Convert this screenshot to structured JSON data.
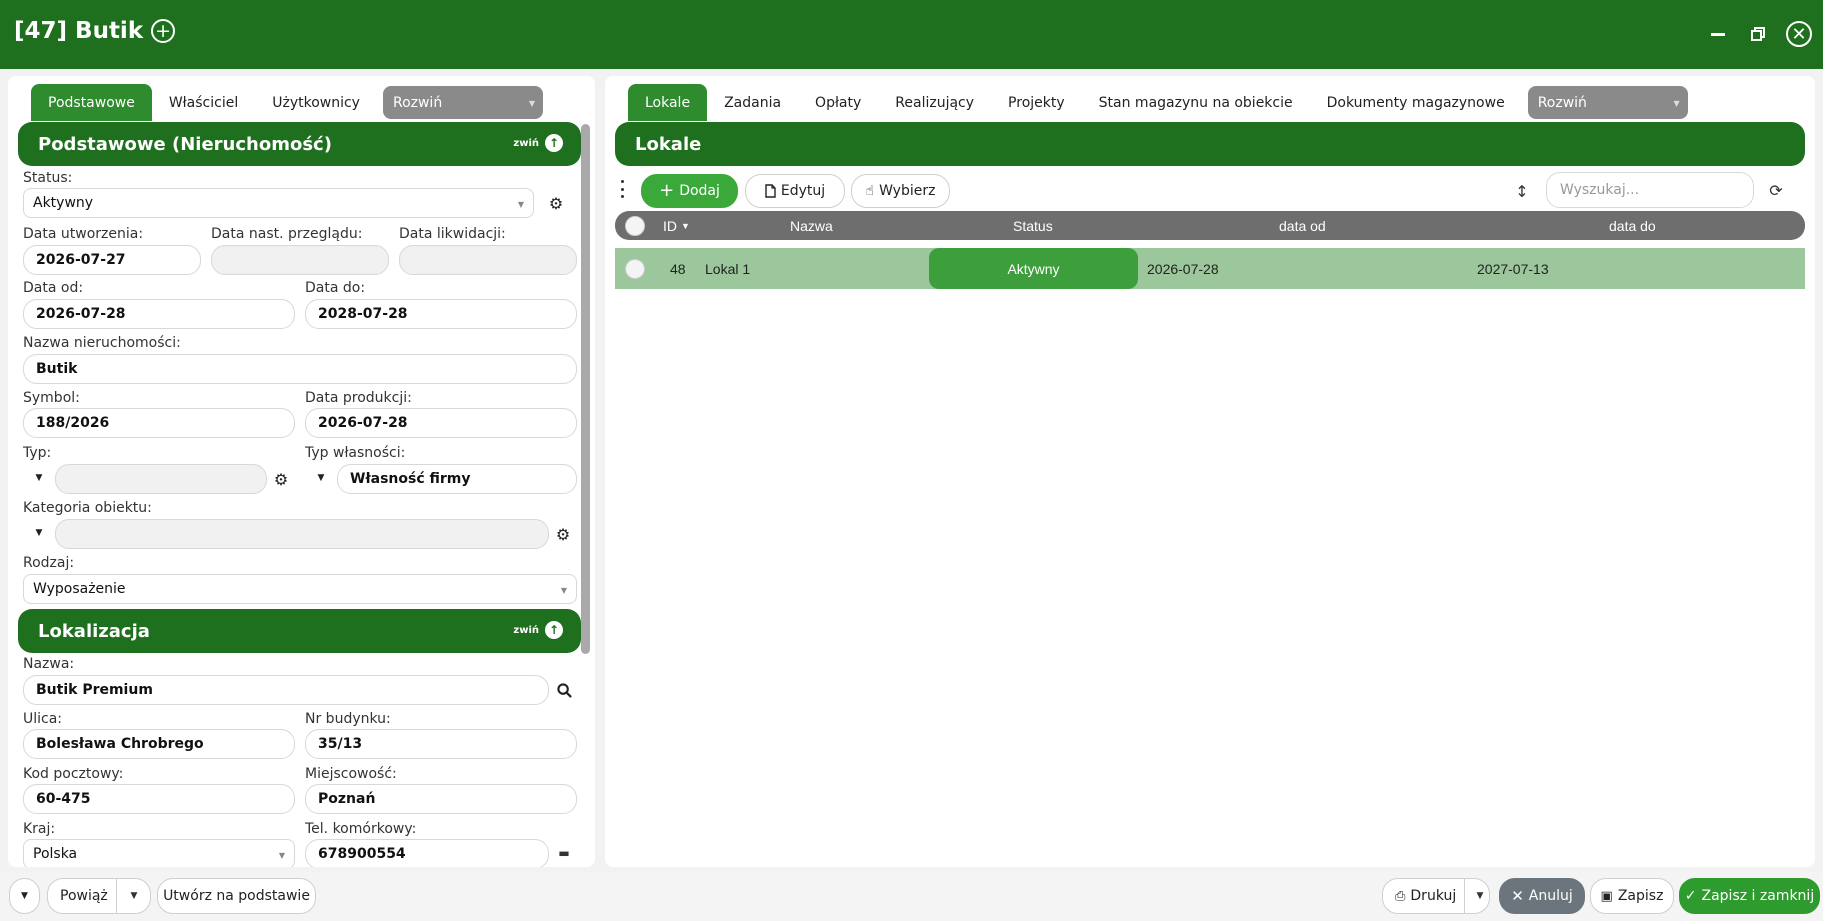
{
  "window": {
    "title": "[47] Butik"
  },
  "left": {
    "tabs": [
      "Podstawowe",
      "Właściciel",
      "Użytkownicy"
    ],
    "expand_label": "Rozwiń",
    "section1": {
      "title": "Podstawowe (Nieruchomość)",
      "collapse_label": "zwiń"
    },
    "fields": {
      "status_label": "Status:",
      "status_value": "Aktywny",
      "data_utw_label": "Data utworzenia:",
      "data_utw": "2026-07-27",
      "data_przegladu_label": "Data nast. przeglądu:",
      "data_przegladu": "",
      "data_likw_label": "Data likwidacji:",
      "data_likw": "",
      "data_od_label": "Data od:",
      "data_od": "2026-07-28",
      "data_do_label": "Data do:",
      "data_do": "2028-07-28",
      "nazwa_label": "Nazwa nieruchomości:",
      "nazwa": "Butik",
      "symbol_label": "Symbol:",
      "symbol": "188/2026",
      "data_prod_label": "Data produkcji:",
      "data_prod": "2026-07-28",
      "typ_label": "Typ:",
      "typ": "",
      "typ_wlasn_label": "Typ własności:",
      "typ_wlasn": "Własność firmy",
      "kategoria_label": "Kategoria obiektu:",
      "kategoria": "",
      "rodzaj_label": "Rodzaj:",
      "rodzaj": "Wyposażenie"
    },
    "section2": {
      "title": "Lokalizacja",
      "collapse_label": "zwiń"
    },
    "loc": {
      "nazwa_label": "Nazwa:",
      "nazwa": "Butik Premium",
      "ulica_label": "Ulica:",
      "ulica": "Bolesława Chrobrego",
      "nr_label": "Nr budynku:",
      "nr": "35/13",
      "kod_label": "Kod pocztowy:",
      "kod": "60-475",
      "miejsc_label": "Miejscowość:",
      "miejsc": "Poznań",
      "kraj_label": "Kraj:",
      "kraj": "Polska",
      "tel_label": "Tel. komórkowy:",
      "tel": "678900554"
    }
  },
  "right": {
    "tabs": [
      "Lokale",
      "Zadania",
      "Opłaty",
      "Realizujący",
      "Projekty",
      "Stan magazynu na obiekcie",
      "Dokumenty magazynowe"
    ],
    "expand_label": "Rozwiń",
    "section_title": "Lokale",
    "toolbar": {
      "add": "Dodaj",
      "edit": "Edytuj",
      "pick": "Wybierz",
      "search_placeholder": "Wyszukaj..."
    },
    "columns": {
      "id": "ID",
      "name": "Nazwa",
      "status": "Status",
      "from": "data od",
      "to": "data do"
    },
    "rows": [
      {
        "id": "48",
        "name": "Lokal 1",
        "status": "Aktywny",
        "from": "2026-07-28",
        "to": "2027-07-13"
      }
    ]
  },
  "bottom": {
    "link": "Powiąż",
    "create_from": "Utwórz na podstawie",
    "print": "Drukuj",
    "cancel": "Anuluj",
    "save": "Zapisz",
    "save_close": "Zapisz i zamknij"
  },
  "colors": {
    "primary": "#1e6f1e",
    "tab_active": "#2e8b2e",
    "row_highlight": "#9cc79c",
    "status_pill": "#3c9f3c"
  }
}
